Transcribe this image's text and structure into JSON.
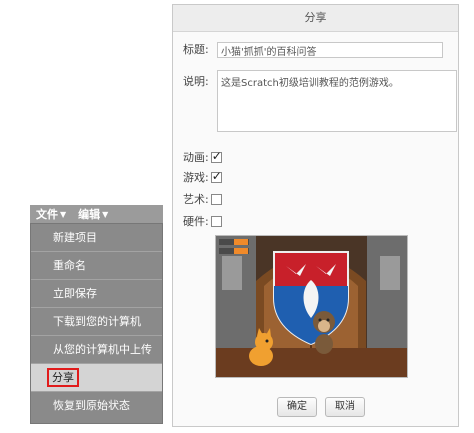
{
  "menubar": {
    "file_label": "文件",
    "edit_label": "编辑"
  },
  "menu": {
    "items": [
      {
        "label": "新建项目"
      },
      {
        "label": "重命名"
      },
      {
        "label": "立即保存"
      },
      {
        "label": "下载到您的计算机"
      },
      {
        "label": "从您的计算机中上传"
      },
      {
        "label": "分享"
      },
      {
        "label": "恢复到原始状态"
      }
    ],
    "selected_index": 5
  },
  "dialog": {
    "title": "分享",
    "title_label": "标题:",
    "title_value": "小猫'抓抓'的百科问答",
    "desc_label": "说明:",
    "desc_value": "这是Scratch初级培训教程的范例游戏。",
    "categories": [
      {
        "label": "动画:",
        "checked": true
      },
      {
        "label": "游戏:",
        "checked": true
      },
      {
        "label": "艺术:",
        "checked": false
      },
      {
        "label": "硬件:",
        "checked": false
      }
    ],
    "ok_label": "确定",
    "cancel_label": "取消"
  },
  "colors": {
    "menu_bg": "#8a8a8a",
    "menu_selected_bg": "#d4d4d4",
    "highlight_border": "#e11b1b",
    "shield_red": "#c8202a",
    "shield_blue": "#1f5fb0"
  }
}
